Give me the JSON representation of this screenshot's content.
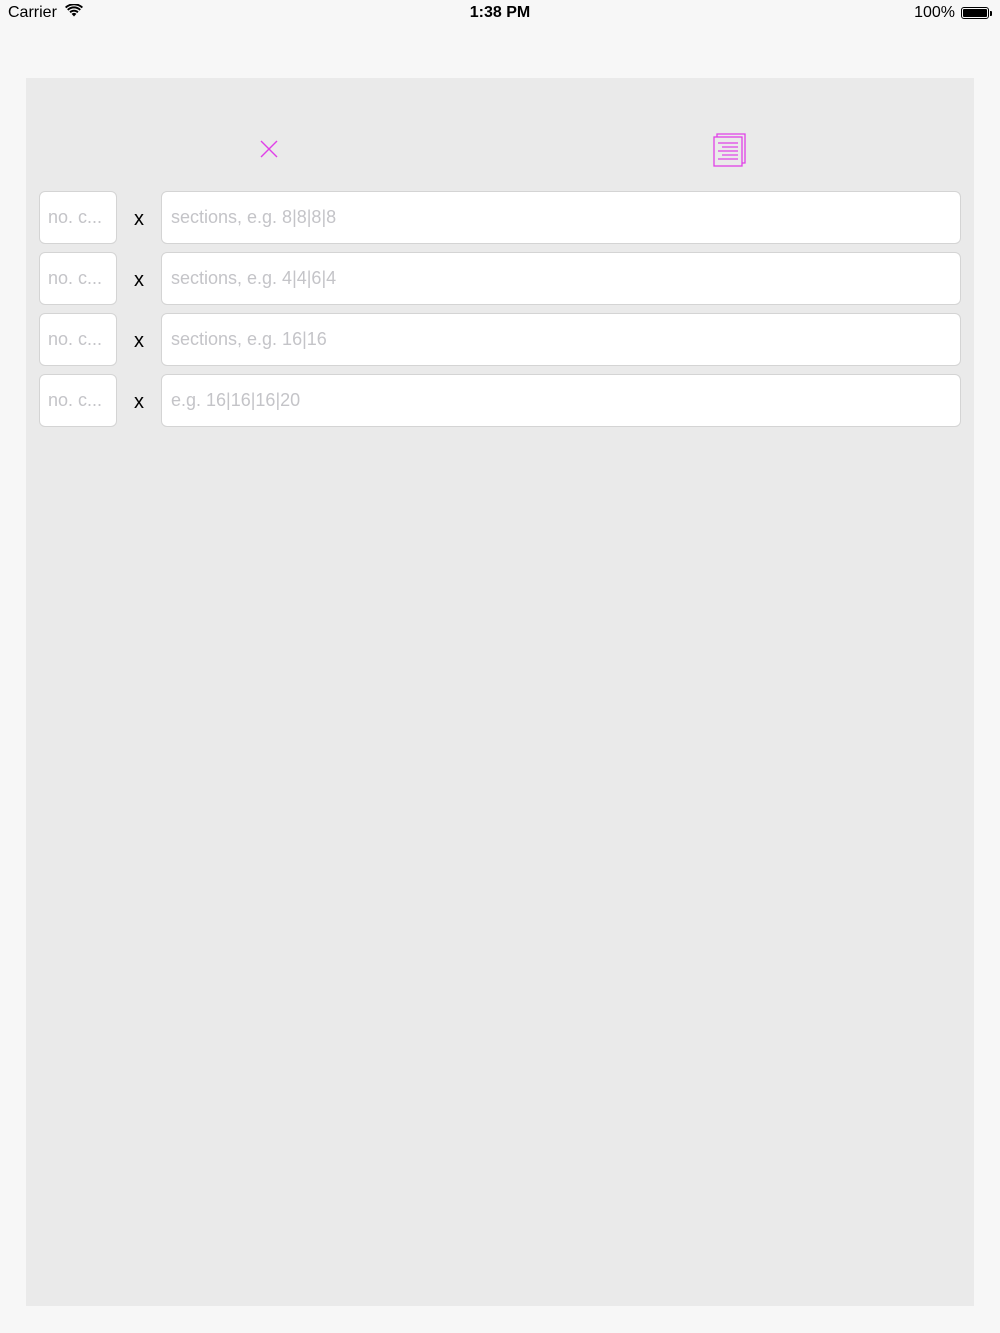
{
  "status_bar": {
    "carrier": "Carrier",
    "time": "1:38 PM",
    "battery": "100%"
  },
  "toolbar": {
    "close_icon": "close-icon",
    "document_icon": "document-list-icon",
    "accent_color": "#e040e8"
  },
  "rows": [
    {
      "count_placeholder": "no. c...",
      "times": "x",
      "sections_placeholder": "sections, e.g. 8|8|8|8"
    },
    {
      "count_placeholder": "no. c...",
      "times": "x",
      "sections_placeholder": "sections, e.g. 4|4|6|4"
    },
    {
      "count_placeholder": "no. c...",
      "times": "x",
      "sections_placeholder": "sections, e.g. 16|16"
    },
    {
      "count_placeholder": "no. c...",
      "times": "x",
      "sections_placeholder": "e.g. 16|16|16|20"
    }
  ]
}
